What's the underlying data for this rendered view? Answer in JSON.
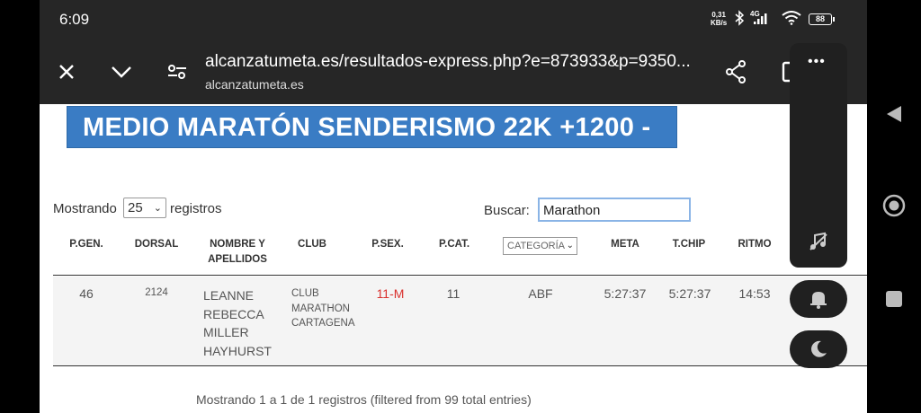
{
  "status_bar": {
    "time": "6:09",
    "net_speed_value": "0,31",
    "net_speed_unit": "KB/s",
    "network_type": "4G",
    "battery": "88"
  },
  "browser": {
    "url": "alcanzatumeta.es/resultados-express.php?e=873933&p=9350...",
    "domain": "alcanzatumeta.es"
  },
  "page": {
    "title": "MEDIO MARATÓN SENDERISMO 22K +1200 -",
    "show_prefix": "Mostrando",
    "page_size": "25",
    "show_suffix": "registros",
    "search_label": "Buscar:",
    "search_value": "Marathon",
    "columns": {
      "pgen": "P.GEN.",
      "dorsal": "DORSAL",
      "nombre_1": "NOMBRE Y",
      "nombre_2": "APELLIDOS",
      "club": "CLUB",
      "psex": "P.SEX.",
      "pcat": "P.CAT.",
      "categoria": "CATEGORÍA",
      "meta": "META",
      "tchip": "T.CHIP",
      "ritmo": "RITMO"
    },
    "rows": [
      {
        "pgen": "46",
        "dorsal": "2124",
        "nombre_lines": [
          "LEANNE",
          "REBECCA",
          "MILLER",
          "HAYHURST"
        ],
        "club_lines": [
          "CLUB",
          "MARATHON",
          "CARTAGENA"
        ],
        "psex": "11-M",
        "pcat": "11",
        "categoria": "ABF",
        "meta": "5:27:37",
        "tchip": "5:27:37",
        "ritmo": "14:53"
      }
    ],
    "footer_info": "Mostrando 1 a 1 de 1 registros (filtered from 99 total entries)"
  },
  "colors": {
    "title_bg": "#3a7cc4",
    "psex_red": "#d9322f",
    "chrome_bg": "#262626"
  }
}
